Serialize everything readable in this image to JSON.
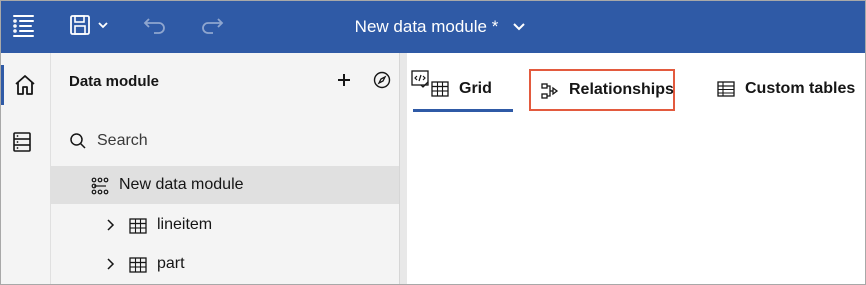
{
  "header": {
    "title": "New data module *",
    "icons": {
      "menu": "hamburger-menu-icon",
      "save": "save-icon",
      "undo": "undo-icon",
      "redo": "redo-icon",
      "title_menu": "chevron-down-icon"
    }
  },
  "rail": {
    "items": [
      {
        "icon": "home-icon",
        "active": true
      },
      {
        "icon": "data-source-icon",
        "active": false
      }
    ]
  },
  "panel": {
    "title": "Data module",
    "actions": [
      "add-icon",
      "compass-icon",
      "code-icon"
    ],
    "search": {
      "placeholder": "Search",
      "value": ""
    },
    "tree": {
      "root": {
        "label": "New data module",
        "icon": "data-module-icon",
        "selected": true
      },
      "children": [
        {
          "label": "lineitem",
          "icon": "table-icon",
          "expanded": false
        },
        {
          "label": "part",
          "icon": "table-icon",
          "expanded": false
        }
      ]
    }
  },
  "tabs": {
    "items": [
      {
        "label": "Grid",
        "icon": "grid-icon",
        "active": true
      },
      {
        "label": "Relationships",
        "icon": "relationships-icon",
        "active": false,
        "highlighted": true
      },
      {
        "label": "Custom tables",
        "icon": "custom-tables-icon",
        "active": false
      }
    ]
  },
  "colors": {
    "header": "#2f5aa6",
    "highlight": "#e35a3e",
    "panel": "#f4f4f4",
    "selected": "#e0e0e0"
  }
}
